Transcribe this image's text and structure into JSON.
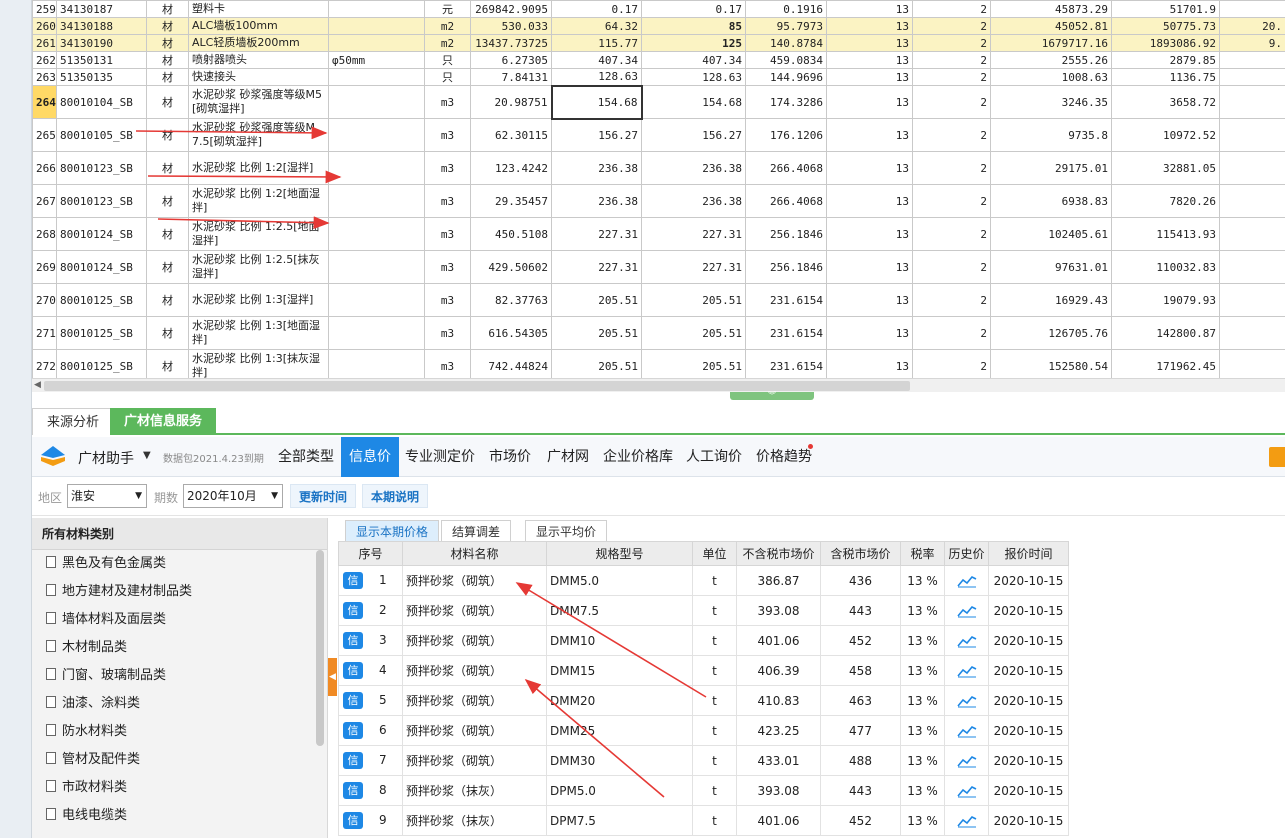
{
  "sheet": {
    "rows": [
      {
        "no": "259",
        "code": "34130187",
        "type": "材",
        "name": "塑料卡",
        "spec": "",
        "unit": "元",
        "qty": "269842.9095",
        "p1": "0.17",
        "p2": "0.17",
        "p3": "0.1916",
        "tax": "13",
        "n2": "2",
        "t1": "45873.29",
        "t2": "51701.9",
        "t3": ""
      },
      {
        "no": "260",
        "code": "34130188",
        "type": "材",
        "name": "ALC墙板100mm",
        "spec": "",
        "unit": "m2",
        "qty": "530.033",
        "p1": "64.32",
        "p2": "85",
        "p3": "95.7973",
        "tax": "13",
        "n2": "2",
        "t1": "45052.81",
        "t2": "50775.73",
        "t3": "20."
      },
      {
        "no": "261",
        "code": "34130190",
        "type": "材",
        "name": "ALC轻质墙板200mm",
        "spec": "",
        "unit": "m2",
        "qty": "13437.73725",
        "p1": "115.77",
        "p2": "125",
        "p3": "140.8784",
        "tax": "13",
        "n2": "2",
        "t1": "1679717.16",
        "t2": "1893086.92",
        "t3": "9."
      },
      {
        "no": "262",
        "code": "51350131",
        "type": "材",
        "name": "喷射器喷头",
        "spec": "φ50mm",
        "unit": "只",
        "qty": "6.27305",
        "p1": "407.34",
        "p2": "407.34",
        "p3": "459.0834",
        "tax": "13",
        "n2": "2",
        "t1": "2555.26",
        "t2": "2879.85",
        "t3": ""
      },
      {
        "no": "263",
        "code": "51350135",
        "type": "材",
        "name": "快速接头",
        "spec": "",
        "unit": "只",
        "qty": "7.84131",
        "p1": "128.63",
        "p2": "128.63",
        "p3": "144.9696",
        "tax": "13",
        "n2": "2",
        "t1": "1008.63",
        "t2": "1136.75",
        "t3": ""
      },
      {
        "no": "264",
        "code": "80010104_SB",
        "type": "材",
        "name": "水泥砂浆 砂浆强度等级M5[砌筑湿拌]",
        "spec": "",
        "unit": "m3",
        "qty": "20.98751",
        "p1": "154.68",
        "p2": "154.68",
        "p3": "174.3286",
        "tax": "13",
        "n2": "2",
        "t1": "3246.35",
        "t2": "3658.72",
        "t3": ""
      },
      {
        "no": "265",
        "code": "80010105_SB",
        "type": "材",
        "name": "水泥砂浆 砂浆强度等级M7.5[砌筑湿拌]",
        "spec": "",
        "unit": "m3",
        "qty": "62.30115",
        "p1": "156.27",
        "p2": "156.27",
        "p3": "176.1206",
        "tax": "13",
        "n2": "2",
        "t1": "9735.8",
        "t2": "10972.52",
        "t3": ""
      },
      {
        "no": "266",
        "code": "80010123_SB",
        "type": "材",
        "name": "水泥砂浆 比例 1:2[湿拌]",
        "spec": "",
        "unit": "m3",
        "qty": "123.4242",
        "p1": "236.38",
        "p2": "236.38",
        "p3": "266.4068",
        "tax": "13",
        "n2": "2",
        "t1": "29175.01",
        "t2": "32881.05",
        "t3": ""
      },
      {
        "no": "267",
        "code": "80010123_SB",
        "type": "材",
        "name": "水泥砂浆 比例 1:2[地面湿拌]",
        "spec": "",
        "unit": "m3",
        "qty": "29.35457",
        "p1": "236.38",
        "p2": "236.38",
        "p3": "266.4068",
        "tax": "13",
        "n2": "2",
        "t1": "6938.83",
        "t2": "7820.26",
        "t3": ""
      },
      {
        "no": "268",
        "code": "80010124_SB",
        "type": "材",
        "name": "水泥砂浆 比例 1:2.5[地面湿拌]",
        "spec": "",
        "unit": "m3",
        "qty": "450.5108",
        "p1": "227.31",
        "p2": "227.31",
        "p3": "256.1846",
        "tax": "13",
        "n2": "2",
        "t1": "102405.61",
        "t2": "115413.93",
        "t3": ""
      },
      {
        "no": "269",
        "code": "80010124_SB",
        "type": "材",
        "name": "水泥砂浆 比例 1:2.5[抹灰湿拌]",
        "spec": "",
        "unit": "m3",
        "qty": "429.50602",
        "p1": "227.31",
        "p2": "227.31",
        "p3": "256.1846",
        "tax": "13",
        "n2": "2",
        "t1": "97631.01",
        "t2": "110032.83",
        "t3": ""
      },
      {
        "no": "270",
        "code": "80010125_SB",
        "type": "材",
        "name": "水泥砂浆 比例 1:3[湿拌]",
        "spec": "",
        "unit": "m3",
        "qty": "82.37763",
        "p1": "205.51",
        "p2": "205.51",
        "p3": "231.6154",
        "tax": "13",
        "n2": "2",
        "t1": "16929.43",
        "t2": "19079.93",
        "t3": ""
      },
      {
        "no": "271",
        "code": "80010125_SB",
        "type": "材",
        "name": "水泥砂浆 比例 1:3[地面湿拌]",
        "spec": "",
        "unit": "m3",
        "qty": "616.54305",
        "p1": "205.51",
        "p2": "205.51",
        "p3": "231.6154",
        "tax": "13",
        "n2": "2",
        "t1": "126705.76",
        "t2": "142800.87",
        "t3": ""
      },
      {
        "no": "272",
        "code": "80010125_SB",
        "type": "材",
        "name": "水泥砂浆 比例 1:3[抹灰湿拌]",
        "spec": "",
        "unit": "m3",
        "qty": "742.44824",
        "p1": "205.51",
        "p2": "205.51",
        "p3": "231.6154",
        "tax": "13",
        "n2": "2",
        "t1": "152580.54",
        "t2": "171962.45",
        "t3": ""
      }
    ]
  },
  "panel_tabs": {
    "source": "来源分析",
    "gcinfo": "广材信息服务"
  },
  "helper": {
    "title": "广材助手",
    "caret": "▼",
    "pkg_info": "数据包2021.4.23到期",
    "nav": [
      "全部类型",
      "信息价",
      "专业测定价",
      "市场价",
      "广材网",
      "企业价格库",
      "人工询价",
      "价格趋势"
    ]
  },
  "filter": {
    "region_label": "地区",
    "region_value": "淮安",
    "period_label": "期数",
    "period_value": "2020年10月",
    "update_btn": "更新时间",
    "desc_btn": "本期说明"
  },
  "categories": {
    "header": "所有材料类别",
    "items": [
      "黑色及有色金属类",
      "地方建材及建材制品类",
      "墙体材料及面层类",
      "木材制品类",
      "门窗、玻璃制品类",
      "油漆、涂料类",
      "防水材料类",
      "管材及配件类",
      "市政材料类",
      "电线电缆类"
    ]
  },
  "sub_tabs": [
    "显示本期价格",
    "结算调差",
    "显示平均价"
  ],
  "price_table": {
    "headers": [
      "序号",
      "材料名称",
      "规格型号",
      "单位",
      "不含税市场价",
      "含税市场价",
      "税率",
      "历史价",
      "报价时间"
    ],
    "badge": "信",
    "rows": [
      {
        "no": "1",
        "name": "预拌砂浆（砌筑）",
        "spec": "DMM5.0",
        "unit": "t",
        "p_ex": "386.87",
        "p_in": "436",
        "rate": "13 %",
        "date": "2020-10-15"
      },
      {
        "no": "2",
        "name": "预拌砂浆（砌筑）",
        "spec": "DMM7.5",
        "unit": "t",
        "p_ex": "393.08",
        "p_in": "443",
        "rate": "13 %",
        "date": "2020-10-15"
      },
      {
        "no": "3",
        "name": "预拌砂浆（砌筑）",
        "spec": "DMM10",
        "unit": "t",
        "p_ex": "401.06",
        "p_in": "452",
        "rate": "13 %",
        "date": "2020-10-15"
      },
      {
        "no": "4",
        "name": "预拌砂浆（砌筑）",
        "spec": "DMM15",
        "unit": "t",
        "p_ex": "406.39",
        "p_in": "458",
        "rate": "13 %",
        "date": "2020-10-15"
      },
      {
        "no": "5",
        "name": "预拌砂浆（砌筑）",
        "spec": "DMM20",
        "unit": "t",
        "p_ex": "410.83",
        "p_in": "463",
        "rate": "13 %",
        "date": "2020-10-15"
      },
      {
        "no": "6",
        "name": "预拌砂浆（砌筑）",
        "spec": "DMM25",
        "unit": "t",
        "p_ex": "423.25",
        "p_in": "477",
        "rate": "13 %",
        "date": "2020-10-15"
      },
      {
        "no": "7",
        "name": "预拌砂浆（砌筑）",
        "spec": "DMM30",
        "unit": "t",
        "p_ex": "433.01",
        "p_in": "488",
        "rate": "13 %",
        "date": "2020-10-15"
      },
      {
        "no": "8",
        "name": "预拌砂浆（抹灰）",
        "spec": "DPM5.0",
        "unit": "t",
        "p_ex": "393.08",
        "p_in": "443",
        "rate": "13 %",
        "date": "2020-10-15"
      },
      {
        "no": "9",
        "name": "预拌砂浆（抹灰）",
        "spec": "DPM7.5",
        "unit": "t",
        "p_ex": "401.06",
        "p_in": "452",
        "rate": "13 %",
        "date": "2020-10-15"
      }
    ]
  },
  "colors": {
    "accent": "#1e88e5",
    "green": "#5cb85c",
    "highlight_row": "#fbf3c3",
    "arrow": "#e53935"
  }
}
